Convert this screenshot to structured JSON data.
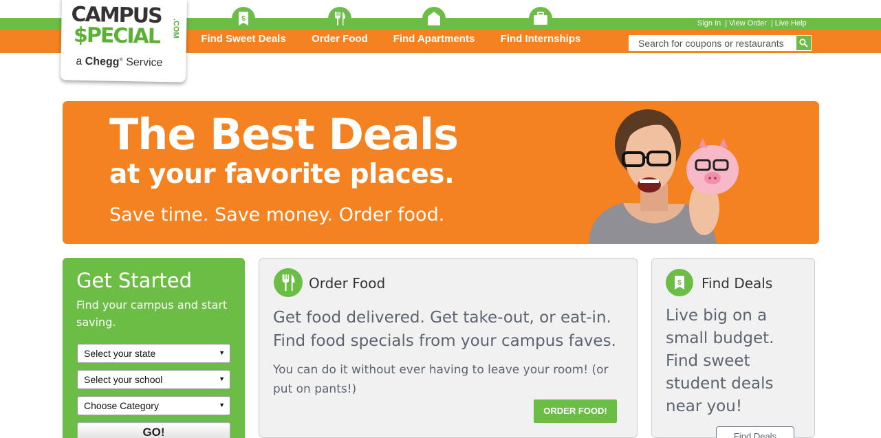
{
  "header": {
    "logo": {
      "line1": "CAMPUS",
      "line2": "$PECIAL",
      "line3": ".COM",
      "tagline_prefix": "a",
      "tagline_brand": "Chegg",
      "tagline_suffix": "Service"
    },
    "top_links": [
      "Sign In",
      "View Order",
      "Live Help"
    ],
    "nav": [
      {
        "label": "Find Sweet Deals",
        "icon": "dollar-tag-icon"
      },
      {
        "label": "Order Food",
        "icon": "fork-knife-icon"
      },
      {
        "label": "Find Apartments",
        "icon": "house-icon"
      },
      {
        "label": "Find Internships",
        "icon": "briefcase-icon"
      }
    ],
    "search": {
      "placeholder": "Search for coupons or restaurants"
    }
  },
  "hero": {
    "title": "The Best Deals",
    "subtitle": "at your favorite places.",
    "tagline": "Save time. Save money. Order food."
  },
  "get_started": {
    "title": "Get Started",
    "text": "Find your campus and start saving.",
    "state_select": "Select your state",
    "school_select": "Select your school",
    "category_select": "Choose Category",
    "go_label": "GO!"
  },
  "order_food": {
    "title": "Order Food",
    "lead": "Get food delivered. Get take-out, or eat-in. Find food specials from your campus faves.",
    "body": "You can do it without ever having to leave your room! (or put on pants!)",
    "button": "ORDER FOOD!"
  },
  "find_deals": {
    "title": "Find Deals",
    "lead": "Live big on a small budget. Find sweet student deals near you!",
    "button": "Find Deals"
  },
  "colors": {
    "orange": "#f58220",
    "green": "#6cbd45",
    "text_gray": "#5c6470"
  }
}
